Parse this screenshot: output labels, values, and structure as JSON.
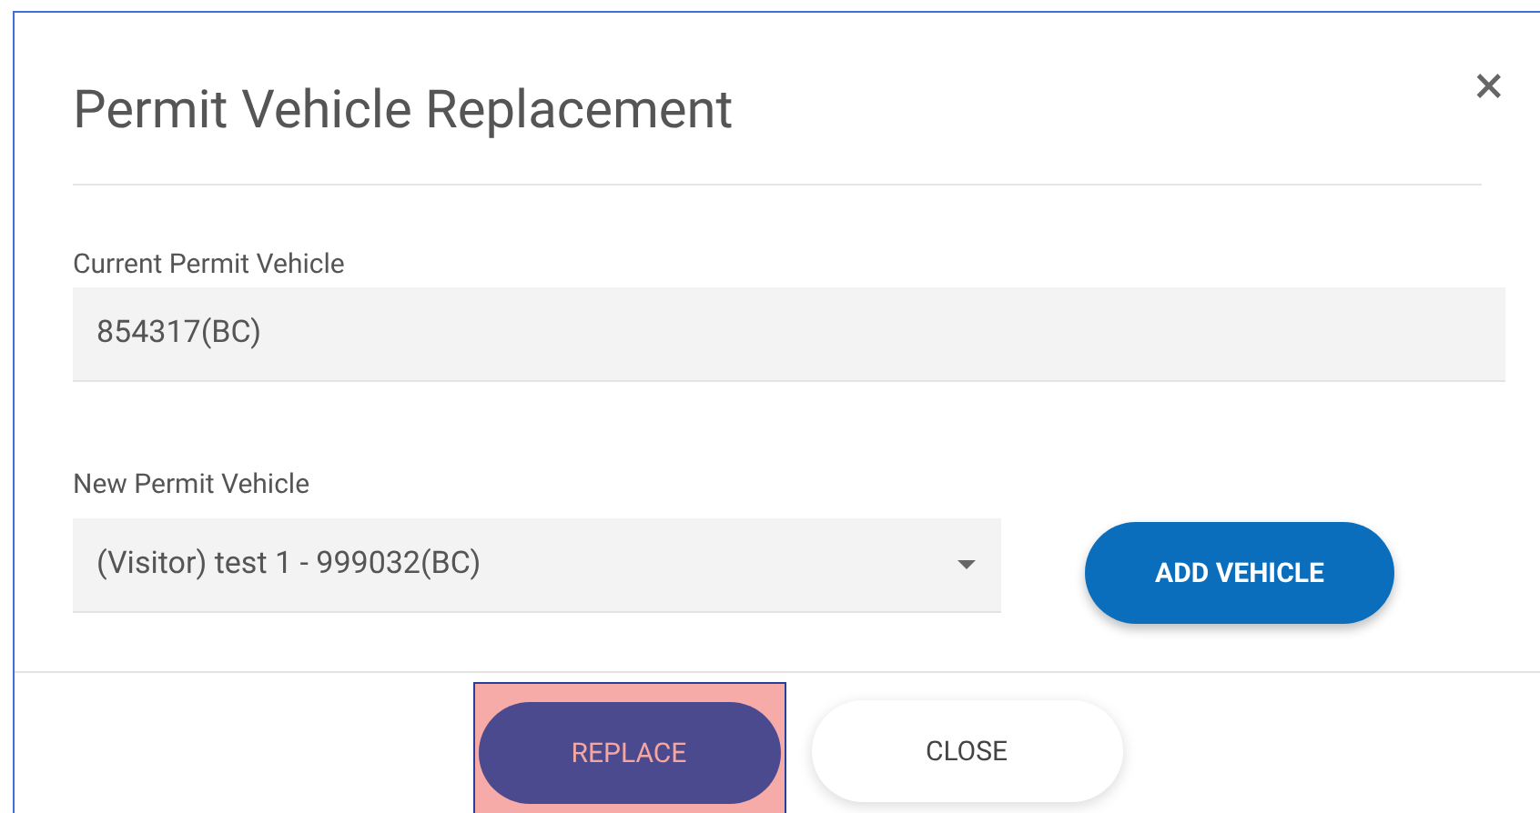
{
  "dialog": {
    "title": "Permit Vehicle Replacement",
    "close_icon": "×"
  },
  "current": {
    "label": "Current Permit Vehicle",
    "value": "854317(BC)"
  },
  "new": {
    "label": "New Permit Vehicle",
    "value": "(Visitor) test 1 - 999032(BC)",
    "add_button": "ADD VEHICLE"
  },
  "footer": [
    {
      "label": "REPLACE",
      "kind": "primary",
      "highlighted": true
    },
    {
      "label": "CLOSE",
      "kind": "secondary",
      "highlighted": false
    }
  ]
}
